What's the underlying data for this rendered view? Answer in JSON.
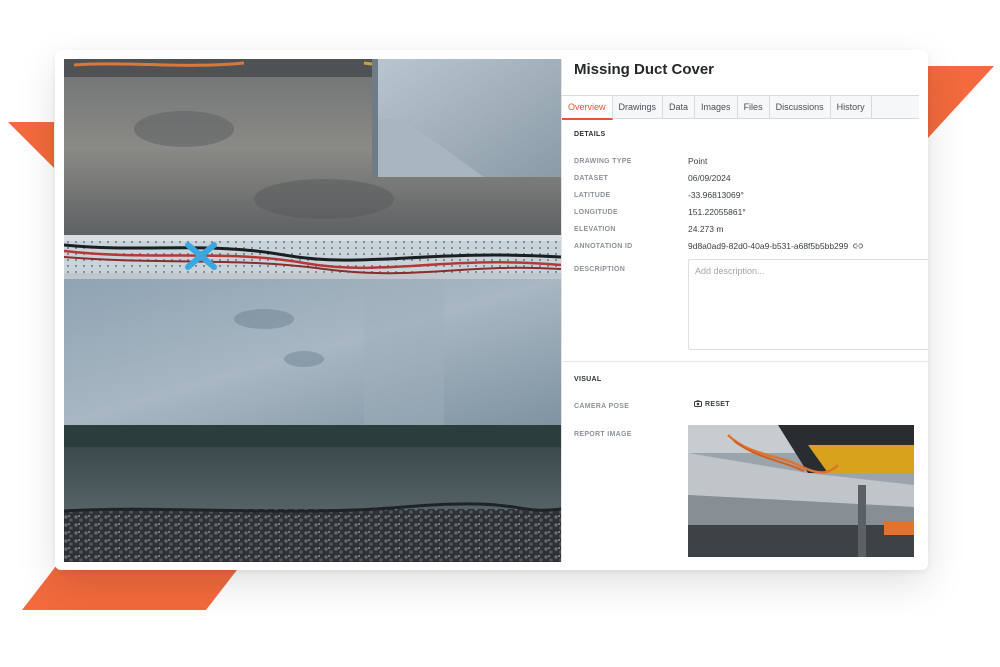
{
  "accent_color": "#f26a3d",
  "annotation": {
    "title": "Missing Duct Cover"
  },
  "tabs": [
    {
      "label": "Overview",
      "active": true
    },
    {
      "label": "Drawings",
      "active": false
    },
    {
      "label": "Data",
      "active": false
    },
    {
      "label": "Images",
      "active": false
    },
    {
      "label": "Files",
      "active": false
    },
    {
      "label": "Discussions",
      "active": false
    },
    {
      "label": "History",
      "active": false
    }
  ],
  "details": {
    "heading": "DETAILS",
    "drawing_type": {
      "label": "DRAWING TYPE",
      "value": "Point"
    },
    "dataset": {
      "label": "DATASET",
      "value": "06/09/2024"
    },
    "latitude": {
      "label": "LATITUDE",
      "value": "-33.96813069°"
    },
    "longitude": {
      "label": "LONGITUDE",
      "value": "151.22055861°"
    },
    "elevation": {
      "label": "ELEVATION",
      "value": "24.273 m"
    },
    "annotation_id": {
      "label": "ANNOTATION ID",
      "value": "9d8a0ad9-82d0-40a9-b531-a68f5b5bb299",
      "icon": "link-icon"
    },
    "description": {
      "label": "DESCRIPTION",
      "value": "",
      "placeholder": "Add description..."
    }
  },
  "visual": {
    "heading": "VISUAL",
    "camera_pose": {
      "label": "CAMERA POSE",
      "button_label": "RESET",
      "button_icon": "camera-icon"
    },
    "report_image": {
      "label": "REPORT IMAGE"
    }
  },
  "viewer": {
    "marker_icon": "point-marker-icon",
    "marker_color": "#3aa8e0"
  }
}
